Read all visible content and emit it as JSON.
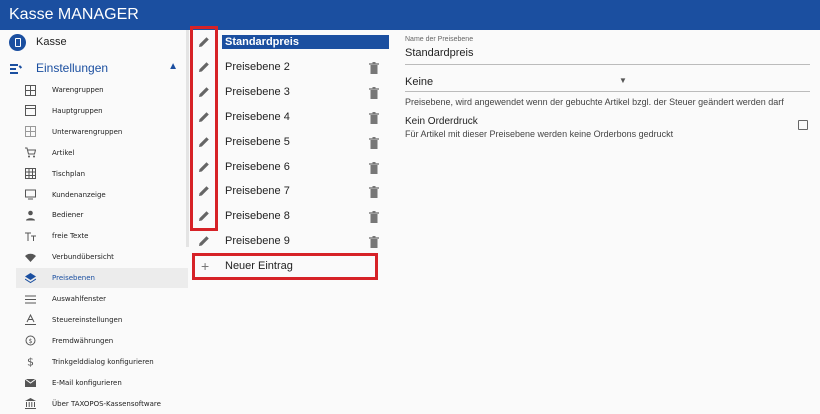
{
  "app": {
    "title": "Kasse MANAGER"
  },
  "sidebar": {
    "kasse": "Kasse",
    "section": "Einstellungen",
    "items": [
      {
        "label": "Warengruppen",
        "icon": "grid-icon"
      },
      {
        "label": "Hauptgruppen",
        "icon": "window-icon"
      },
      {
        "label": "Unterwarengruppen",
        "icon": "subgrid-icon"
      },
      {
        "label": "Artikel",
        "icon": "cart-icon"
      },
      {
        "label": "Tischplan",
        "icon": "table-grid-icon"
      },
      {
        "label": "Kundenanzeige",
        "icon": "monitor-icon"
      },
      {
        "label": "Bediener",
        "icon": "person-icon"
      },
      {
        "label": "freie Texte",
        "icon": "text-icon"
      },
      {
        "label": "Verbundübersicht",
        "icon": "wifi-icon"
      },
      {
        "label": "Preisebenen",
        "icon": "layers-icon",
        "active": true
      },
      {
        "label": "Auswahlfenster",
        "icon": "menu-lines-icon"
      },
      {
        "label": "Steuereinstellungen",
        "icon": "tax-icon"
      },
      {
        "label": "Fremdwährungen",
        "icon": "currency-exchange-icon"
      },
      {
        "label": "Trinkgelddialog konfigurieren",
        "icon": "dollar-icon"
      },
      {
        "label": "E-Mail konfigurieren",
        "icon": "mail-icon"
      },
      {
        "label": "Über TAXOPOS-Kassensoftware",
        "icon": "bank-icon"
      }
    ]
  },
  "list": {
    "rows": [
      {
        "label": "Standardpreis",
        "selected": true
      },
      {
        "label": "Preisebene 2"
      },
      {
        "label": "Preisebene 3"
      },
      {
        "label": "Preisebene 4"
      },
      {
        "label": "Preisebene 5"
      },
      {
        "label": "Preisebene 6"
      },
      {
        "label": "Preisebene 7"
      },
      {
        "label": "Preisebene 8"
      },
      {
        "label": "Preisebene 9"
      }
    ],
    "new_entry": "Neuer Eintrag",
    "new_entry_symbol": "+"
  },
  "detail": {
    "name_caption": "Name der Preisebene",
    "name_value": "Standardpreis",
    "select_value": "Keine",
    "select_help": "Preisebene, wird angewendet wenn der gebuchte Artikel bzgl. der Steuer geändert werden darf",
    "no_order_title": "Kein Orderdruck",
    "no_order_sub": "Für Artikel mit dieser Preisebene werden keine Orderbons gedruckt",
    "no_order_checked": false
  },
  "colors": {
    "brand": "#1b4fa0",
    "highlight": "#d62227"
  }
}
